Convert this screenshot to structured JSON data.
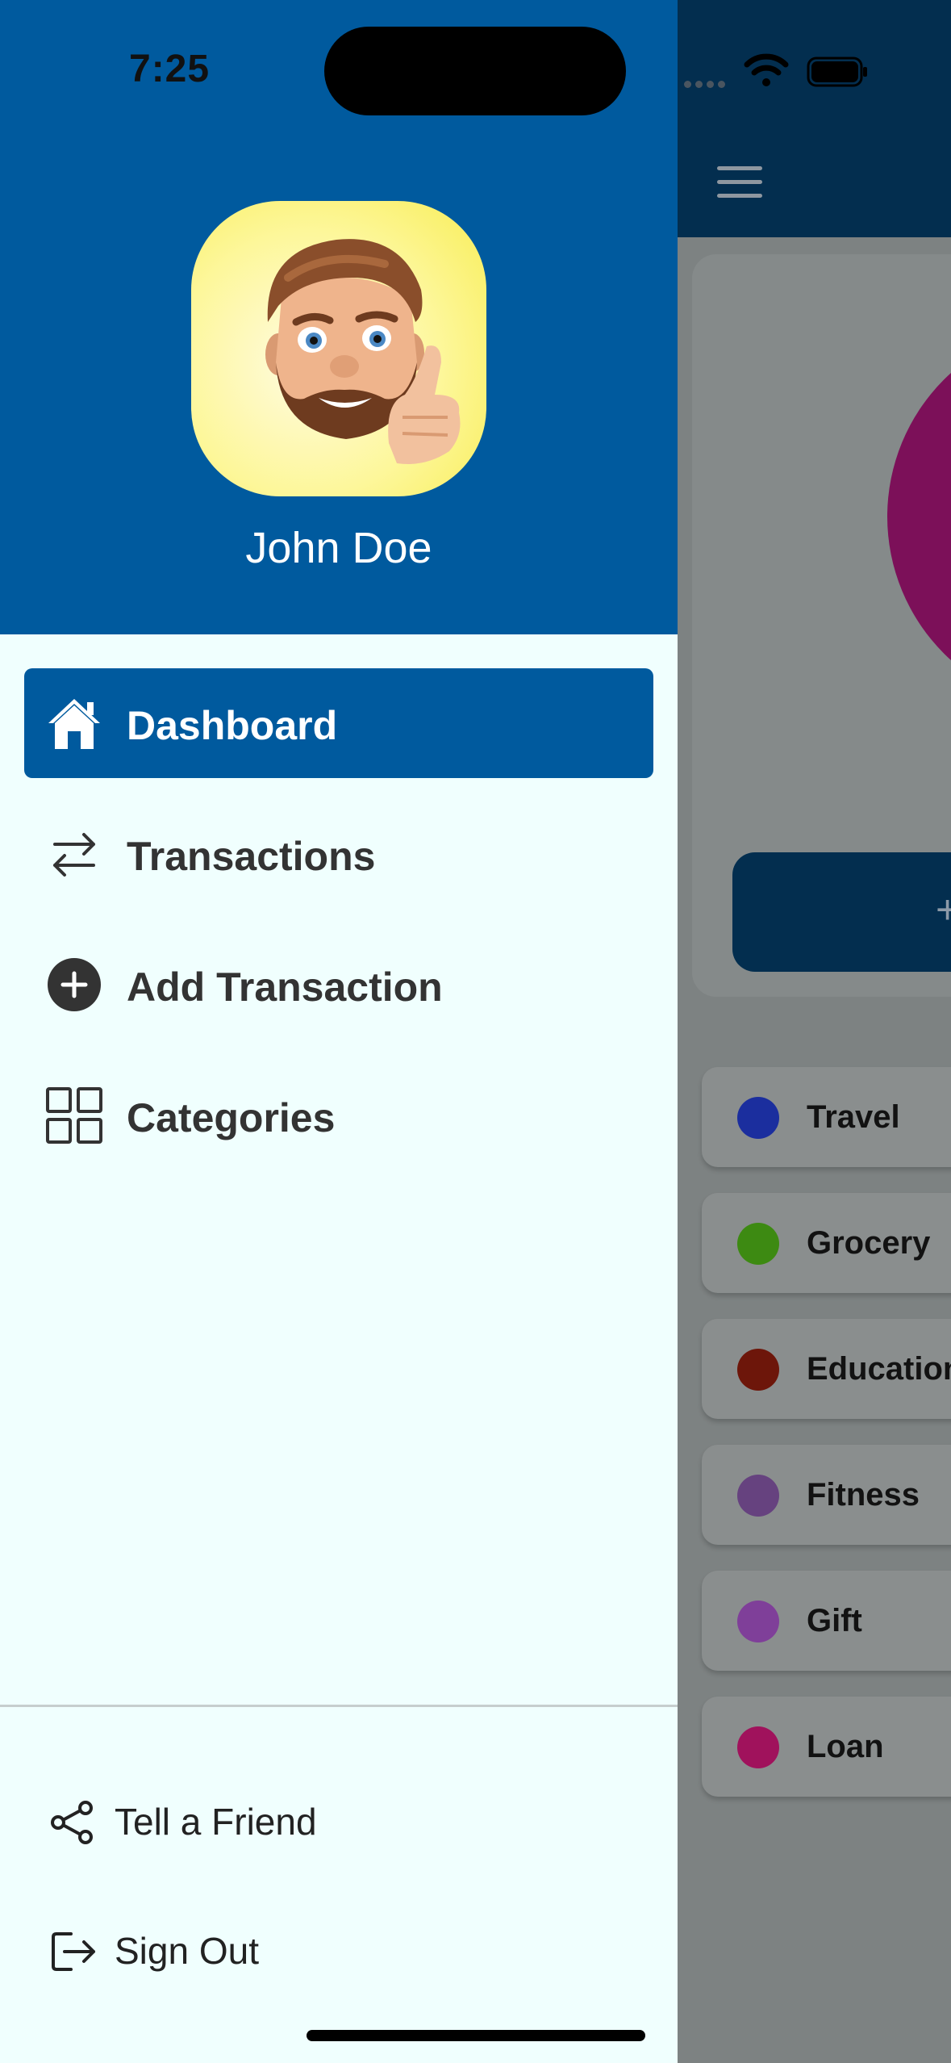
{
  "status_bar": {
    "time": "7:25"
  },
  "drawer": {
    "user_name": "John Doe",
    "menu": [
      {
        "label": "Dashboard",
        "icon": "home-icon",
        "active": true
      },
      {
        "label": "Transactions",
        "icon": "swap-arrows-icon",
        "active": false
      },
      {
        "label": "Add Transaction",
        "icon": "add-circle-icon",
        "active": false
      },
      {
        "label": "Categories",
        "icon": "grid-icon",
        "active": false
      }
    ],
    "footer": [
      {
        "label": "Tell a Friend",
        "icon": "share-icon"
      },
      {
        "label": "Sign Out",
        "icon": "sign-out-icon"
      }
    ]
  },
  "background_app": {
    "add_button_label": "+",
    "categories": [
      {
        "label": "Travel",
        "color": "#1b2e9e"
      },
      {
        "label": "Grocery",
        "color": "#3d8a12"
      },
      {
        "label": "Education",
        "color": "#6d160a"
      },
      {
        "label": "Fitness",
        "color": "#66427f"
      },
      {
        "label": "Gift",
        "color": "#7f3f99"
      },
      {
        "label": "Loan",
        "color": "#a0125c"
      }
    ]
  },
  "colors": {
    "drawer_header": "#005a9e",
    "active_item": "#005a9e",
    "drawer_bg": "#f0fffe"
  }
}
